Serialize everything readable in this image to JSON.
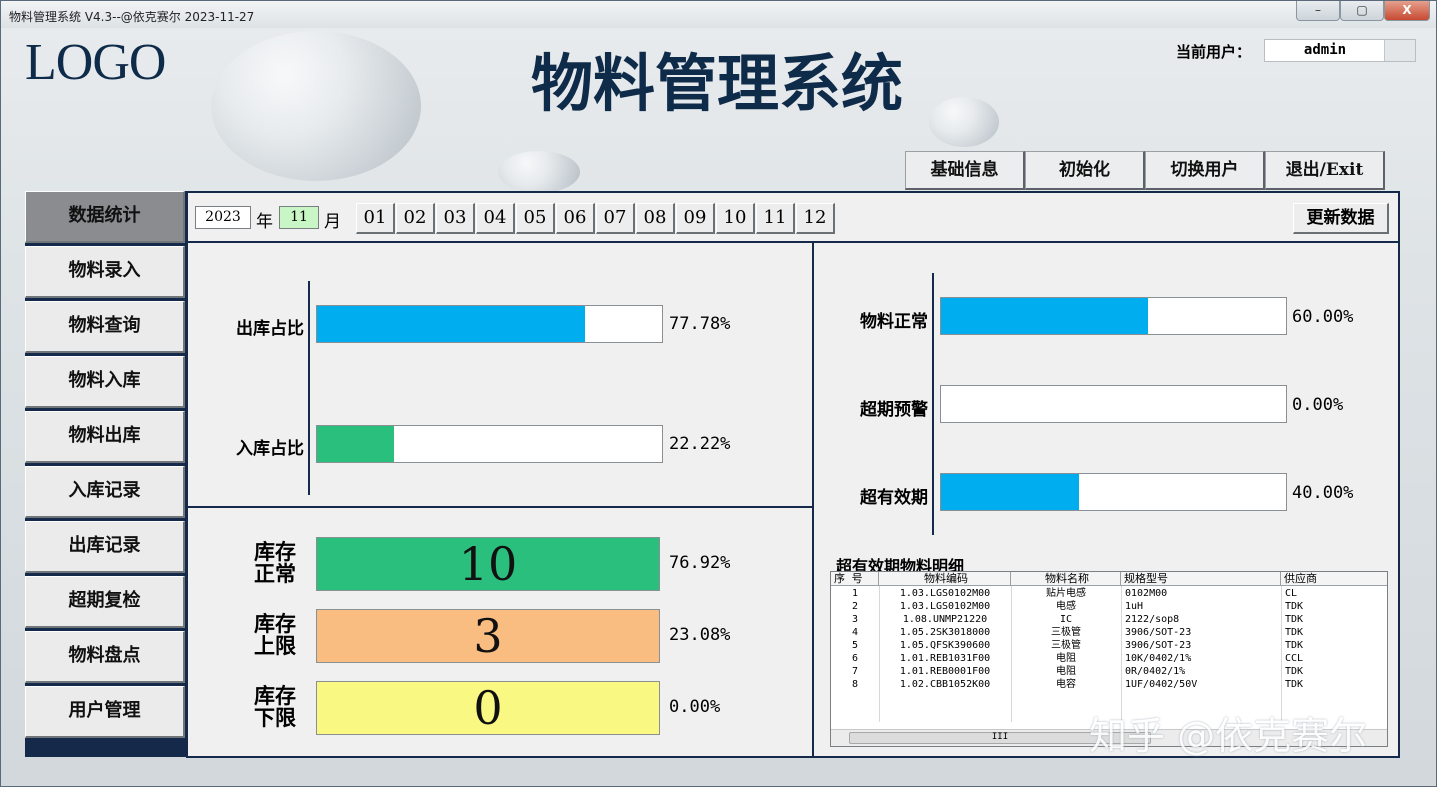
{
  "window": {
    "title": "物料管理系统 V4.3--@依克赛尔  2023-11-27",
    "controls": {
      "minimize": "–",
      "maximize": "▢",
      "close": "X"
    }
  },
  "header": {
    "logo": "LOGO",
    "app_title": "物料管理系统",
    "user_label": "当前用户：",
    "user_value": "admin"
  },
  "top_buttons": [
    "基础信息",
    "初始化",
    "切换用户",
    "退出/Exit"
  ],
  "nav": {
    "items": [
      "数据统计",
      "物料录入",
      "物料查询",
      "物料入库",
      "物料出库",
      "入库记录",
      "出库记录",
      "超期复检",
      "物料盘点",
      "用户管理"
    ],
    "active": "数据统计"
  },
  "toolbar": {
    "year": "2023",
    "year_label": "年",
    "month": "11",
    "month_label": "月",
    "months": [
      "01",
      "02",
      "03",
      "04",
      "05",
      "06",
      "07",
      "08",
      "09",
      "10",
      "11",
      "12"
    ],
    "refresh_label": "更新数据"
  },
  "ratio_bars": [
    {
      "label": "出库占比",
      "value": 0.7778,
      "pct": "77.78%",
      "color": "#00aeef"
    },
    {
      "label": "入库占比",
      "value": 0.2222,
      "pct": "22.22%",
      "color": "#2bbf7e"
    }
  ],
  "stock_status": [
    {
      "label_line1": "库存",
      "label_line2": "正常",
      "count": "10",
      "pct": "76.92%",
      "color": "#2bbf7e"
    },
    {
      "label_line1": "库存",
      "label_line2": "上限",
      "count": "3",
      "pct": "23.08%",
      "color": "#f9bd82"
    },
    {
      "label_line1": "库存",
      "label_line2": "下限",
      "count": "0",
      "pct": "0.00%",
      "color": "#f8f883"
    }
  ],
  "validity_bars": [
    {
      "label": "物料正常",
      "value": 0.6,
      "pct": "60.00%",
      "color": "#00aeef"
    },
    {
      "label": "超期预警",
      "value": 0.0,
      "pct": "0.00%",
      "color": "#00aeef"
    },
    {
      "label": "超有效期",
      "value": 0.4,
      "pct": "40.00%",
      "color": "#00aeef"
    }
  ],
  "expired_table": {
    "title": "超有效期物料明细",
    "columns": [
      "序 号",
      "物料编码",
      "物料名称",
      "规格型号",
      "供应商"
    ],
    "rows": [
      [
        "1",
        "1.03.LGS0102M00",
        "贴片电感",
        "0102M00",
        "CL"
      ],
      [
        "2",
        "1.03.LGS0102M00",
        "电感",
        "1uH",
        "TDK"
      ],
      [
        "3",
        "1.08.UNMP21220",
        "IC",
        "2122/sop8",
        "TDK"
      ],
      [
        "4",
        "1.05.2SK3018000",
        "三极管",
        "3906/SOT-23",
        "TDK"
      ],
      [
        "5",
        "1.05.QFSK390600",
        "三极管",
        "3906/SOT-23",
        "TDK"
      ],
      [
        "6",
        "1.01.REB1031F00",
        "电阻",
        "10K/0402/1%",
        "CCL"
      ],
      [
        "7",
        "1.01.REB0001F00",
        "电阻",
        "0R/0402/1%",
        "TDK"
      ],
      [
        "8",
        "1.02.CBB1052K00",
        "电容",
        "1UF/0402/50V",
        "TDK"
      ]
    ],
    "scroll_thumb": "III"
  },
  "watermark": "知乎 @依克赛尔"
}
